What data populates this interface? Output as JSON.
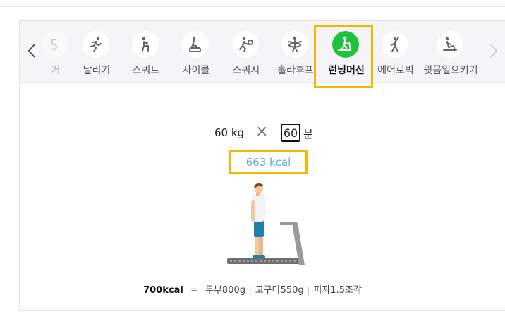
{
  "exercise_tabs": [
    {
      "label": "거",
      "icon": "partial-exercise-icon",
      "faded": true
    },
    {
      "label": "달리기",
      "icon": "running-icon"
    },
    {
      "label": "스쿼트",
      "icon": "squat-icon"
    },
    {
      "label": "사이클",
      "icon": "cycle-icon"
    },
    {
      "label": "스쿼시",
      "icon": "squash-icon"
    },
    {
      "label": "훌라후프",
      "icon": "hula-hoop-icon"
    },
    {
      "label": "런닝머신",
      "icon": "treadmill-icon",
      "active": true
    },
    {
      "label": "에어로빅",
      "icon": "aerobic-icon"
    },
    {
      "label": "윗몸일으키기",
      "icon": "situp-icon"
    }
  ],
  "calculator": {
    "weight": "60 kg",
    "times_sign": "×",
    "minutes": "60",
    "minutes_unit": "분",
    "result": "663  kcal"
  },
  "equivalence": {
    "kcal": "700kcal",
    "equals": "=",
    "foods": [
      "두부800g",
      "고구마550g",
      "피자1.5조각"
    ]
  },
  "colors": {
    "active_tab": "#1ec23c",
    "highlight": "#f5b800",
    "kcal_text": "#5aaee0"
  }
}
